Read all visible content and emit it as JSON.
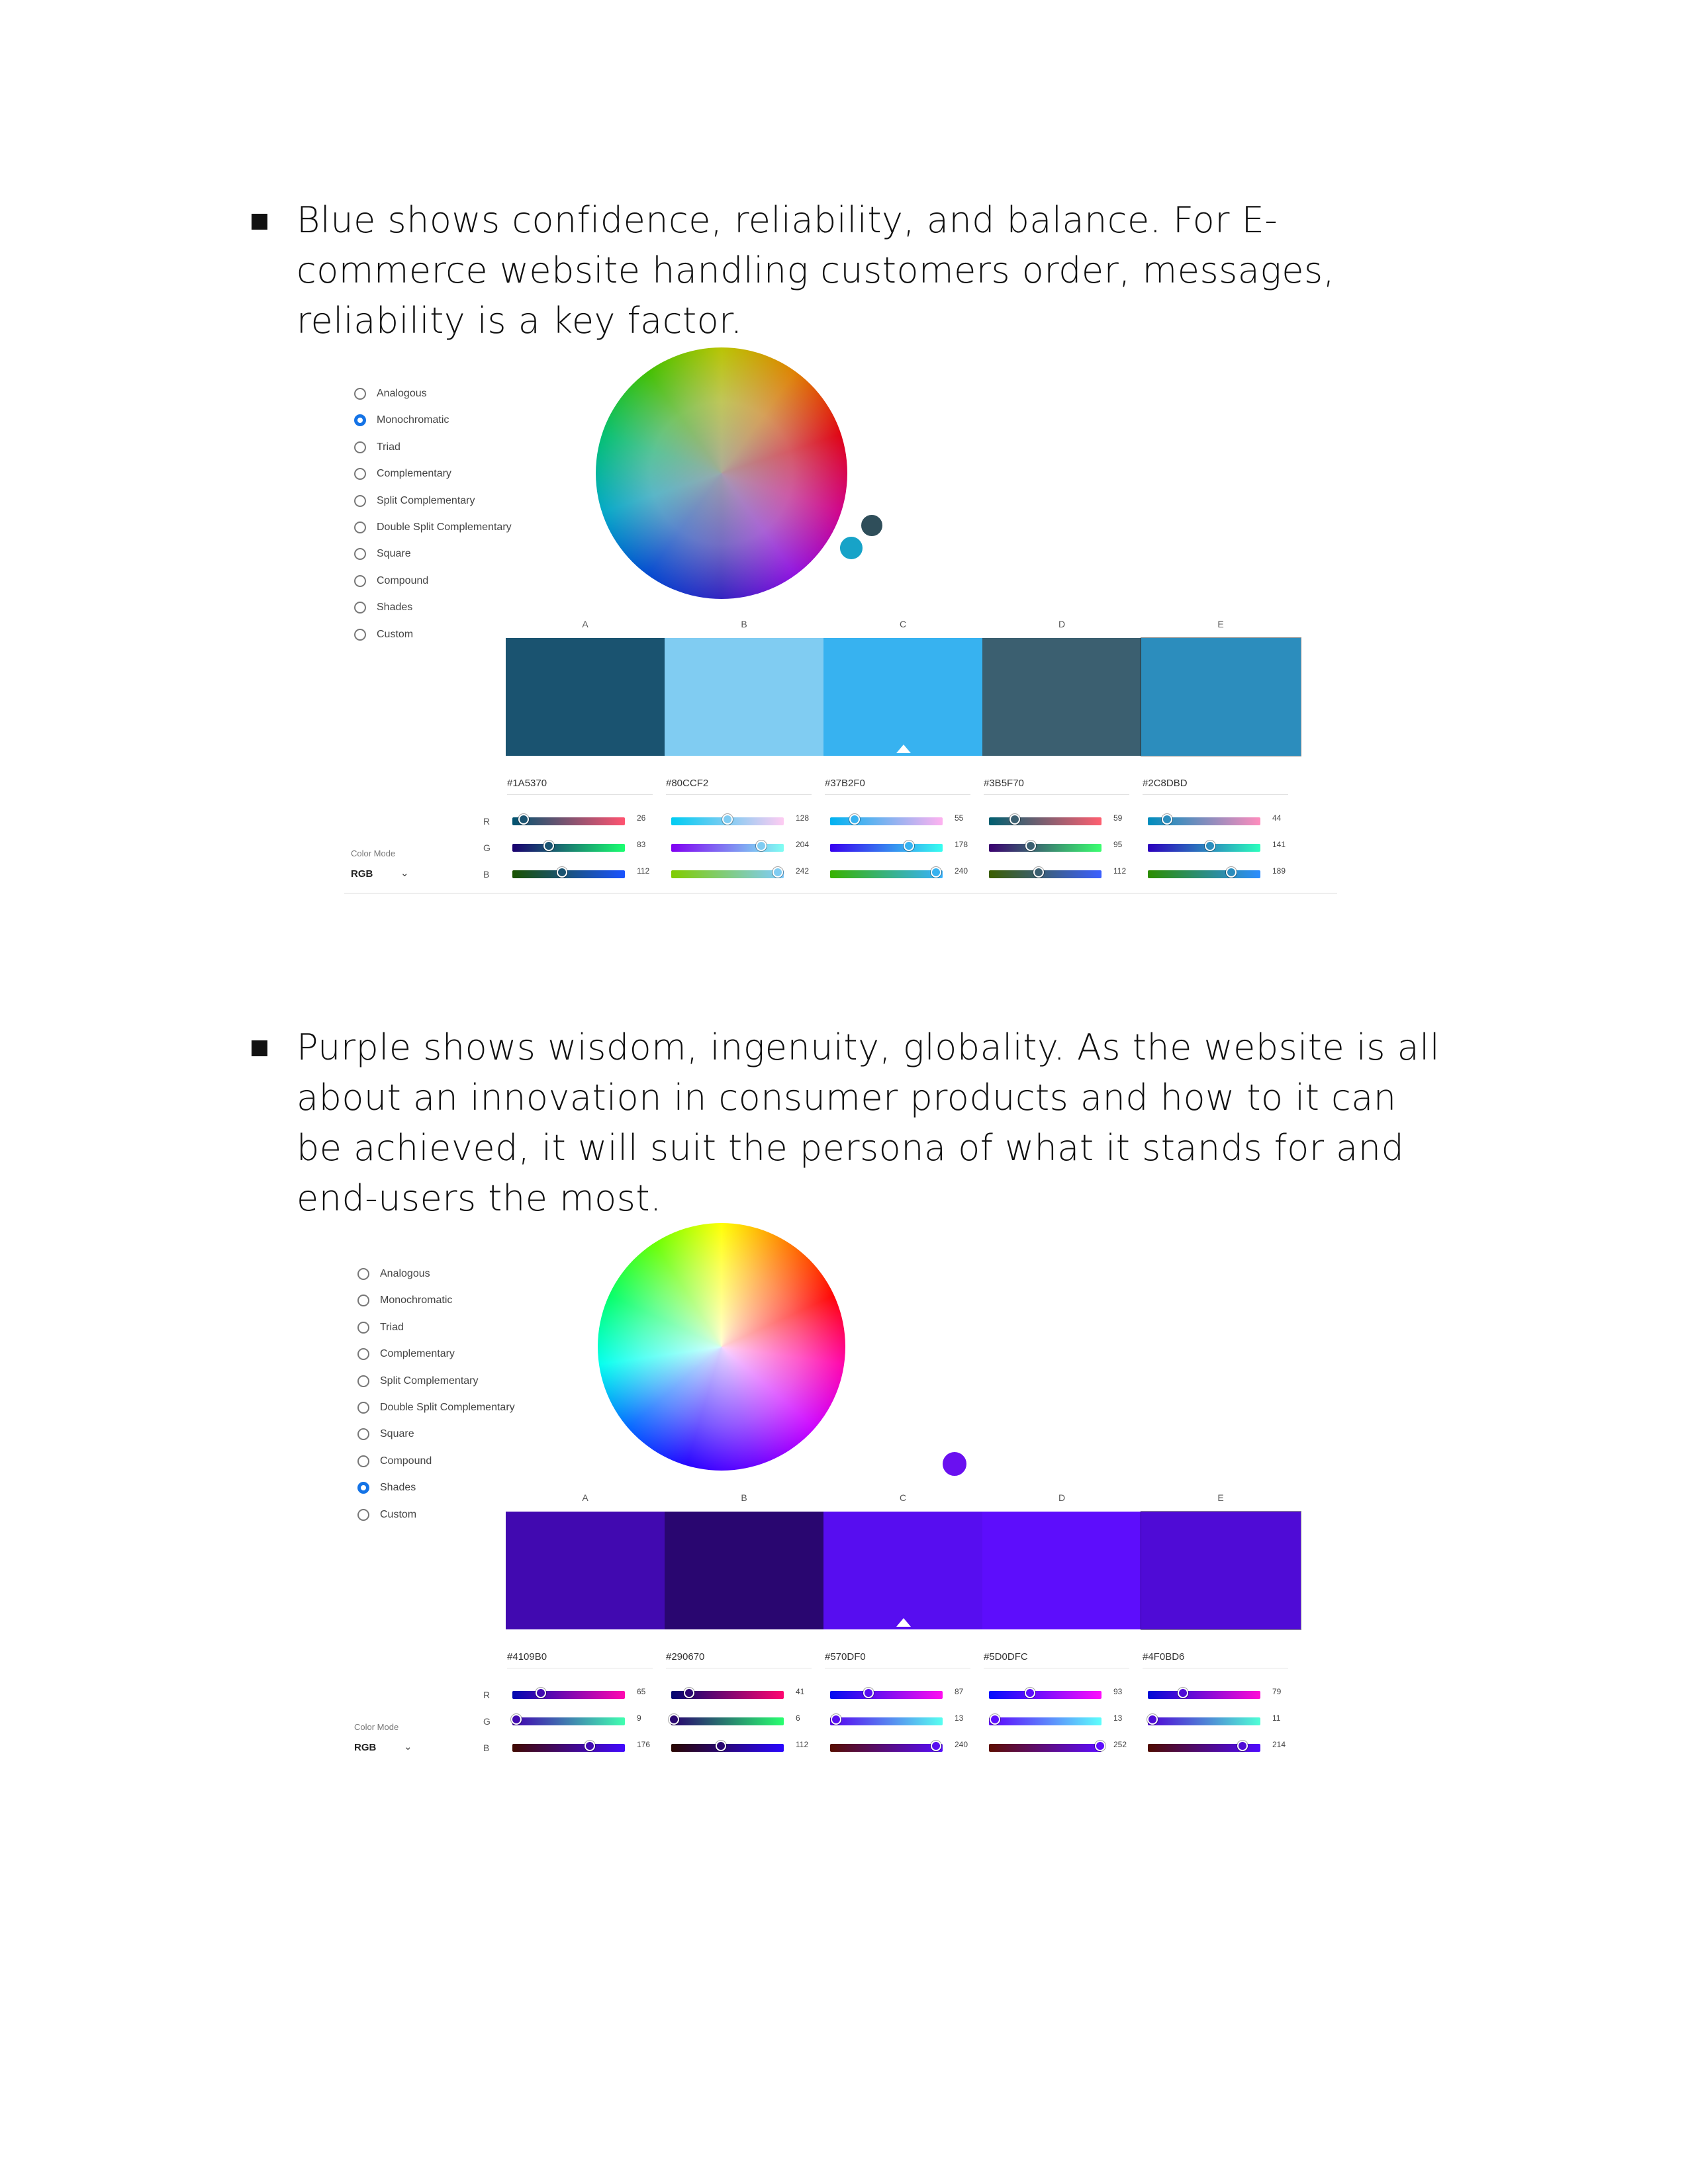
{
  "paragraphs": [
    {
      "lines": [
        "Blue shows confidence, reliability, and balance. For E-",
        "commerce website handling customers order, messages,",
        "reliability is a key factor."
      ]
    },
    {
      "lines": [
        "Purple shows wisdom, ingenuity, globality. As the website is all",
        "about an innovation in consumer products and how to it can",
        "be achieved, it will suit the persona of what it stands for and",
        "end-users the most."
      ]
    }
  ],
  "harmony_rules": [
    "Analogous",
    "Monochromatic",
    "Triad",
    "Complementary",
    "Split Complementary",
    "Double Split Complementary",
    "Square",
    "Compound",
    "Shades",
    "Custom"
  ],
  "columns": [
    "A",
    "B",
    "C",
    "D",
    "E"
  ],
  "channels": [
    "R",
    "G",
    "B"
  ],
  "color_mode": {
    "label": "Color Mode",
    "value": "RGB"
  },
  "panels": [
    {
      "selected_rule": "Monochromatic",
      "active_swatch": 2,
      "swatches": [
        {
          "hex": "#1A5370",
          "color": "#1a5370",
          "r": 26,
          "g": 83,
          "b": 112
        },
        {
          "hex": "#80CCF2",
          "color": "#80ccf2",
          "r": 128,
          "g": 204,
          "b": 242
        },
        {
          "hex": "#37B2F0",
          "color": "#37b2f0",
          "r": 55,
          "g": 178,
          "b": 240
        },
        {
          "hex": "#3B5F70",
          "color": "#3b5f70",
          "r": 59,
          "g": 95,
          "b": 112
        },
        {
          "hex": "#2C8DBD",
          "color": "#2c8dbd",
          "r": 44,
          "g": 141,
          "b": 189
        }
      ]
    },
    {
      "selected_rule": "Shades",
      "active_swatch": 2,
      "swatches": [
        {
          "hex": "#4109B0",
          "color": "#4109b0",
          "r": 65,
          "g": 9,
          "b": 176
        },
        {
          "hex": "#290670",
          "color": "#290670",
          "r": 41,
          "g": 6,
          "b": 112
        },
        {
          "hex": "#570DF0",
          "color": "#570df0",
          "r": 87,
          "g": 13,
          "b": 240
        },
        {
          "hex": "#5D0DFC",
          "color": "#5d0dfc",
          "r": 93,
          "g": 13,
          "b": 252
        },
        {
          "hex": "#4F0BD6",
          "color": "#4f0bd6",
          "r": 79,
          "g": 11,
          "b": 214
        }
      ]
    }
  ]
}
